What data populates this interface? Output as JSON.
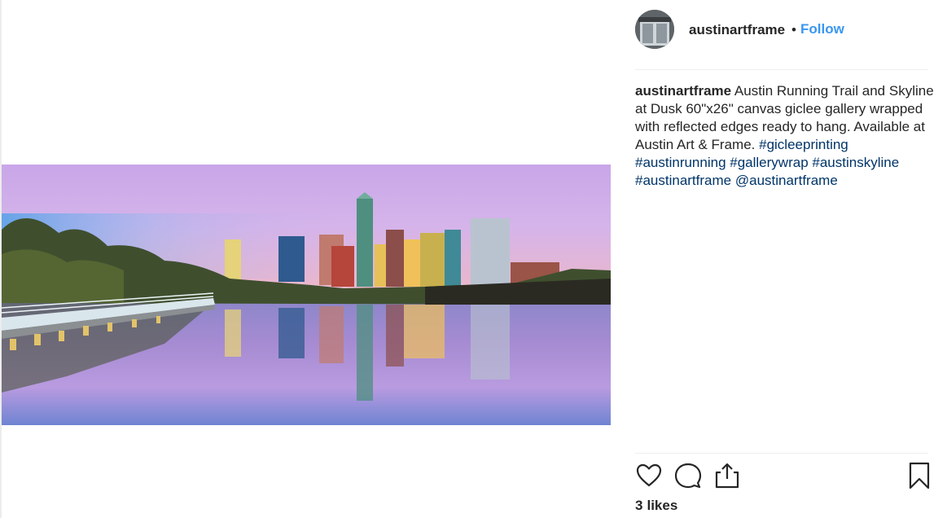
{
  "post": {
    "username": "austinartframe",
    "separator": "•",
    "follow_label": "Follow",
    "media": {
      "alt": "Austin skyline at dusk reflected in the river with a running trail boardwalk"
    },
    "caption": {
      "username": "austinartframe",
      "text": "Austin Running Trail and Skyline at Dusk 60\"x26\" canvas giclee gallery wrapped with reflected edges ready to hang. Available at Austin Art & Frame.",
      "hashtags": [
        "#gicleeprinting",
        "#austinrunning",
        "#gallerywrap",
        "#austinskyline",
        "#austinartframe"
      ],
      "mention": "@austinartframe"
    },
    "likes": {
      "count": "3",
      "label": "likes"
    },
    "icons": {
      "like": "heart-icon",
      "comment": "comment-icon",
      "share": "share-icon",
      "save": "bookmark-icon"
    },
    "colors": {
      "link": "#3897f0",
      "hashtag": "#003569",
      "text": "#262626"
    }
  }
}
